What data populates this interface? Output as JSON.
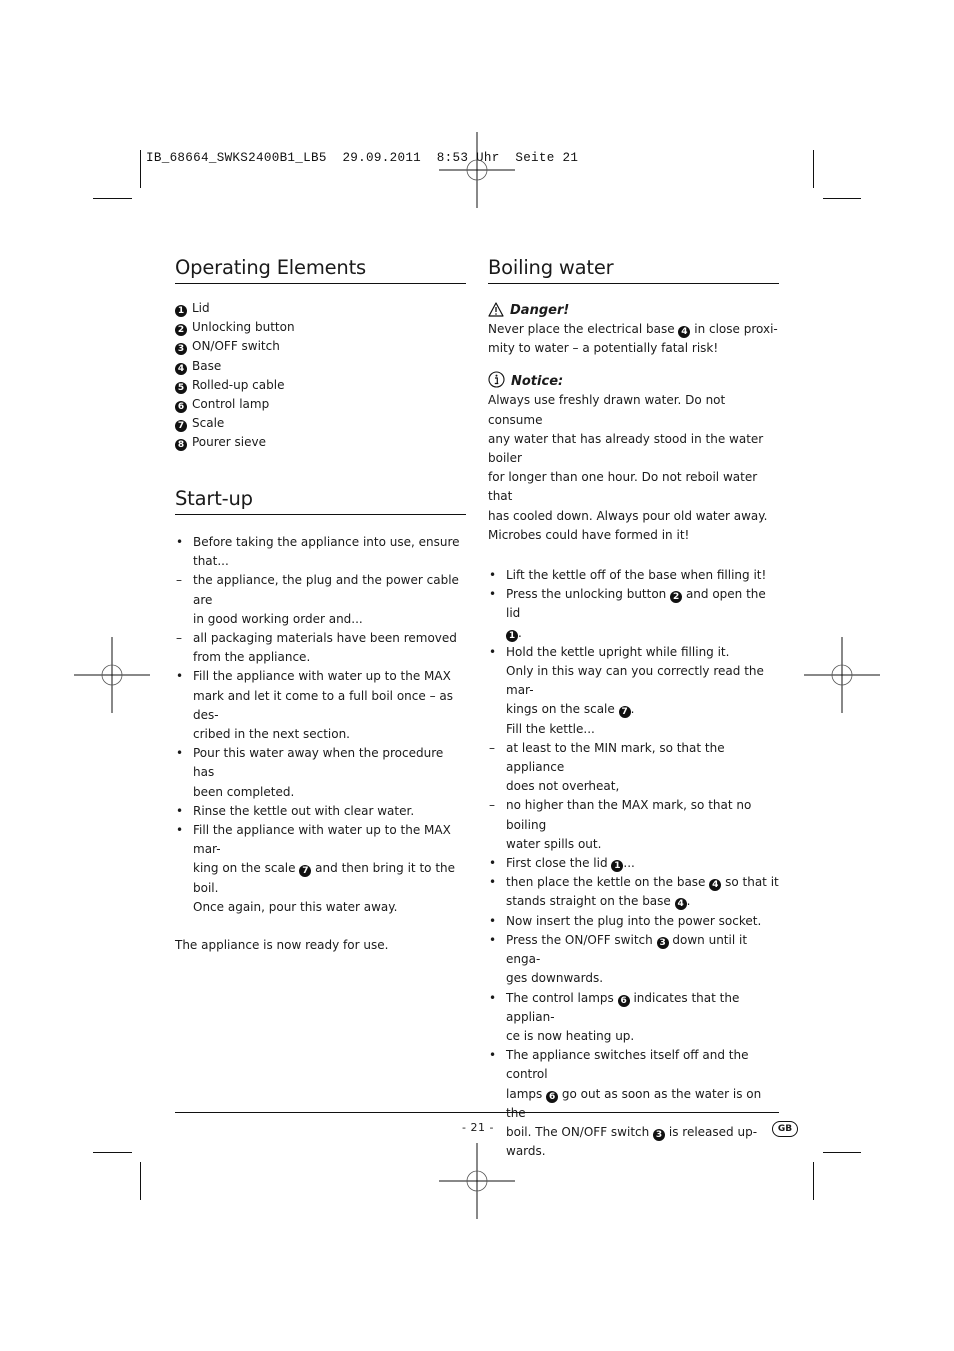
{
  "slug": {
    "file": "IB_68664_SWKS2400B1_LB5",
    "date": "29.09.2011",
    "time": "8:53 Uhr",
    "page": "Seite 21"
  },
  "operating_elements": {
    "title": "Operating Elements",
    "items": [
      {
        "num": "1",
        "label": "Lid"
      },
      {
        "num": "2",
        "label": "Unlocking button"
      },
      {
        "num": "3",
        "label": "ON/OFF switch"
      },
      {
        "num": "4",
        "label": "Base"
      },
      {
        "num": "5",
        "label": "Rolled-up cable"
      },
      {
        "num": "6",
        "label": "Control lamp"
      },
      {
        "num": "7",
        "label": "Scale"
      },
      {
        "num": "8",
        "label": "Pourer sieve"
      }
    ]
  },
  "startup": {
    "title": "Start-up",
    "lines": [
      {
        "marker": "•",
        "text": "Before taking the appliance into use, ensure that..."
      },
      {
        "marker": "–",
        "text": "the appliance, the plug and the power cable are"
      },
      {
        "marker": "",
        "text": "in good working order and..."
      },
      {
        "marker": "–",
        "text": "all packaging materials have been removed"
      },
      {
        "marker": "",
        "text": "from the appliance."
      },
      {
        "marker": "•",
        "text": "Fill the appliance with water up to the MAX"
      },
      {
        "marker": "",
        "text": "mark and let it come to a full boil once – as des-"
      },
      {
        "marker": "",
        "text": "cribed in the next section."
      },
      {
        "marker": "•",
        "text": "Pour this water away when the procedure has"
      },
      {
        "marker": "",
        "text": "been completed."
      },
      {
        "marker": "•",
        "text": "Rinse the kettle out with clear water."
      },
      {
        "marker": "•",
        "text": "Fill the appliance with water up to the MAX mar-"
      },
      {
        "marker": "",
        "text": "king on the scale",
        "ref": "7",
        "after": "and then bring it to the boil."
      },
      {
        "marker": "",
        "text": "Once again, pour this water away."
      }
    ],
    "ready": "The appliance is now ready for use."
  },
  "boiling": {
    "title": "Boiling water",
    "danger": {
      "icon": "warning-triangle-icon",
      "label": "Danger!",
      "line1_before": "Never place the electrical base",
      "line1_ref": "4",
      "line1_after": "in close proxi-",
      "line2": "mity to water – a potentially fatal risk!"
    },
    "notice": {
      "icon": "info-circle-icon",
      "label": "Notice:",
      "lines": [
        "Always use freshly drawn water. Do not consume",
        "any water that has already stood in the water boiler",
        "for longer than one hour. Do not reboil water that",
        "has cooled down. Always pour old water away.",
        "Microbes could have formed in it!"
      ]
    },
    "lines": [
      {
        "marker": "•",
        "text": "Lift the kettle off of the base when filling it!"
      },
      {
        "marker": "•",
        "text": "Press the unlocking button",
        "ref": "2",
        "after": "and open the lid"
      },
      {
        "marker": "",
        "text": "",
        "ref": "1",
        "after": "."
      },
      {
        "marker": "•",
        "text": "Hold the kettle upright while filling it."
      },
      {
        "marker": "",
        "text": "Only in this way can you correctly read the mar-"
      },
      {
        "marker": "",
        "text": "kings on the scale",
        "ref": "7",
        "after": "."
      },
      {
        "marker": "",
        "text": "Fill the kettle..."
      },
      {
        "marker": "–",
        "text": "at least to the MIN mark, so that the appliance"
      },
      {
        "marker": "",
        "text": "does not overheat,"
      },
      {
        "marker": "–",
        "text": "no higher than the MAX mark, so that no boiling"
      },
      {
        "marker": "",
        "text": "water spills out."
      },
      {
        "marker": "•",
        "text": "First close the lid",
        "ref": "1",
        "after": "..."
      },
      {
        "marker": "•",
        "text": "then place the kettle on the base",
        "ref": "4",
        "after": "so that it"
      },
      {
        "marker": "",
        "text": "stands straight on the base",
        "ref": "4",
        "after": "."
      },
      {
        "marker": "•",
        "text": "Now insert the plug into the power socket."
      },
      {
        "marker": "•",
        "text": "Press the ON/OFF switch",
        "ref": "3",
        "after": "down until it enga-"
      },
      {
        "marker": "",
        "text": "ges downwards."
      },
      {
        "marker": "•",
        "text": "The control lamps",
        "ref": "6",
        "after": "indicates that the applian-"
      },
      {
        "marker": "",
        "text": "ce is now heating up."
      },
      {
        "marker": "•",
        "text": "The appliance switches itself off and the control"
      },
      {
        "marker": "",
        "text": "lamps",
        "ref": "6",
        "after": "go out as soon as the water is on the"
      },
      {
        "marker": "",
        "text": "boil. The ON/OFF switch",
        "ref": "3",
        "after": "is released up-"
      },
      {
        "marker": "",
        "text": "wards."
      }
    ]
  },
  "footer": {
    "page_number": "- 21 -",
    "country_badge": "GB"
  }
}
